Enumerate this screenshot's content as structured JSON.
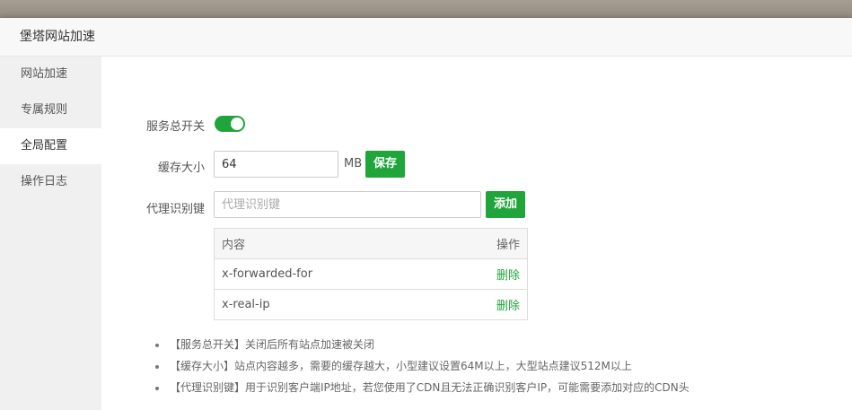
{
  "dialog": {
    "title": "堡塔网站加速"
  },
  "sidebar": {
    "items": [
      {
        "label": "网站加速",
        "active": false
      },
      {
        "label": "专属规则",
        "active": false
      },
      {
        "label": "全局配置",
        "active": true
      },
      {
        "label": "操作日志",
        "active": false
      }
    ]
  },
  "form": {
    "service_switch": {
      "label": "服务总开关",
      "enabled": true
    },
    "cache_size": {
      "label": "缓存大小",
      "value": "64",
      "unit": "MB",
      "save_label": "保存"
    },
    "proxy_key": {
      "label": "代理识别键",
      "placeholder": "代理识别键",
      "add_label": "添加"
    }
  },
  "table": {
    "headers": {
      "content": "内容",
      "operation": "操作"
    },
    "rows": [
      {
        "content": "x-forwarded-for",
        "action": "删除"
      },
      {
        "content": "x-real-ip",
        "action": "删除"
      }
    ]
  },
  "tips": [
    "【服务总开关】关闭后所有站点加速被关闭",
    "【缓存大小】站点内容越多，需要的缓存越大，小型建议设置64M以上，大型站点建议512M以上",
    "【代理识别键】用于识别客户端IP地址，若您使用了CDN且无法正确识别客户IP，可能需要添加对应的CDN头"
  ],
  "colors": {
    "accent": "#20a53a",
    "sidebar_bg": "#f0f0f0",
    "title_bg": "#f8f8f8"
  }
}
